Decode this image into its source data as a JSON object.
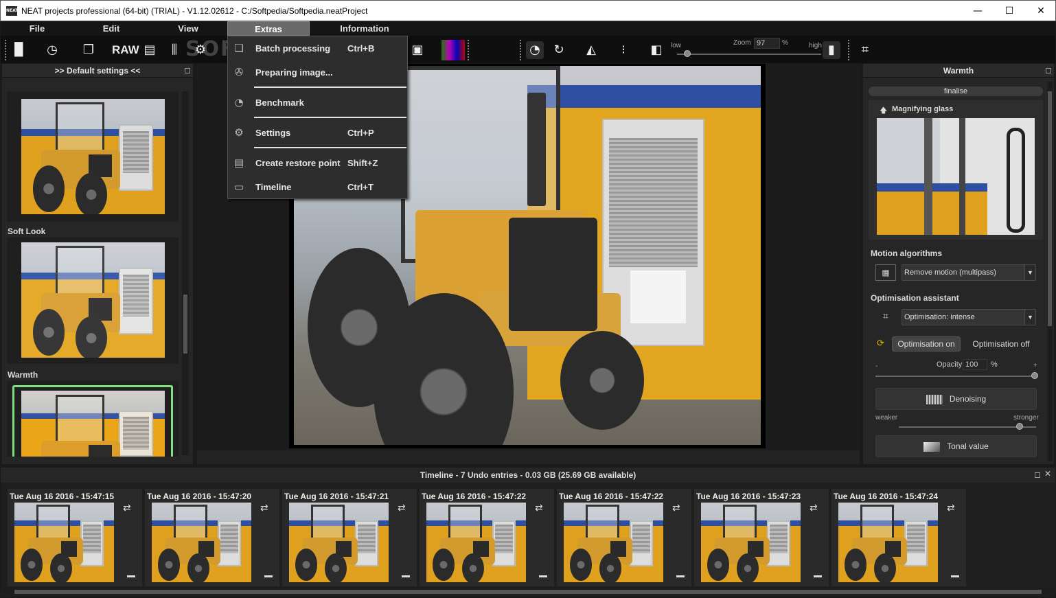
{
  "window": {
    "logo_text": "NEAT",
    "title": "NEAT projects professional (64-bit) (TRIAL) - V1.12.02612 - C:/Softpedia/Softpedia.neatProject",
    "minimize_glyph": "—",
    "maximize_glyph": "☐",
    "close_glyph": "✕"
  },
  "menubar": {
    "items": [
      {
        "label": "File"
      },
      {
        "label": "Edit"
      },
      {
        "label": "View"
      },
      {
        "label": "Extras"
      },
      {
        "label": "Information"
      }
    ]
  },
  "toolbar": {
    "raw_label": "RAW",
    "zoom_label": "Zoom",
    "zoom_value": "97",
    "zoom_unit": "%",
    "low_label": "low",
    "high_label": "high",
    "watermark": "SOFTPEDIA"
  },
  "extras_menu": {
    "items": [
      {
        "icon": "batch-icon",
        "label": "Batch processing",
        "shortcut": "Ctrl+B"
      },
      {
        "icon": "film-reel-icon",
        "label": "Preparing image...",
        "shortcut": ""
      },
      {
        "icon": "speedometer-icon",
        "label": "Benchmark",
        "shortcut": ""
      },
      {
        "icon": "gears-icon",
        "label": "Settings",
        "shortcut": "Ctrl+P"
      },
      {
        "icon": "restore-point-icon",
        "label": "Create restore point",
        "shortcut": "Shift+Z"
      },
      {
        "icon": "timeline-icon",
        "label": "Timeline",
        "shortcut": "Ctrl+T"
      }
    ]
  },
  "left_panel": {
    "header": ">> Default settings <<",
    "presets": [
      {
        "label": "Soft Look"
      },
      {
        "label": "Warmth"
      }
    ]
  },
  "right_panel": {
    "header": "Warmth",
    "finalise_label": "finalise",
    "magnifier_title": "Magnifying glass",
    "motion_title": "Motion algorithms",
    "motion_value": "Remove motion (multipass)",
    "optimisation_title": "Optimisation assistant",
    "optimisation_value": "Optimisation: intense",
    "optimisation_on": "Optimisation on",
    "optimisation_off": "Optimisation off",
    "opacity_label": "Opacity",
    "opacity_value": "100",
    "opacity_unit": "%",
    "opacity_minus": "-",
    "opacity_plus": "+",
    "opacity_level": 1.0,
    "denoising_label": "Denoising",
    "denoise_weaker": "weaker",
    "denoise_stronger": "stronger",
    "denoise_level": 0.88,
    "tonal_label": "Tonal value"
  },
  "timeline": {
    "header": "Timeline - 7 Undo entries - 0.03 GB (25.69 GB available)",
    "entries": [
      {
        "date": "Tue Aug 16 2016 - 15:47:15"
      },
      {
        "date": "Tue Aug 16 2016 - 15:47:20"
      },
      {
        "date": "Tue Aug 16 2016 - 15:47:21"
      },
      {
        "date": "Tue Aug 16 2016 - 15:47:22"
      },
      {
        "date": "Tue Aug 16 2016 - 15:47:22"
      },
      {
        "date": "Tue Aug 16 2016 - 15:47:23"
      },
      {
        "date": "Tue Aug 16 2016 - 15:47:24"
      }
    ]
  },
  "colors": {
    "accent_selected": "#7ee07e",
    "background": "#1a1a1a",
    "panel": "#262626"
  }
}
